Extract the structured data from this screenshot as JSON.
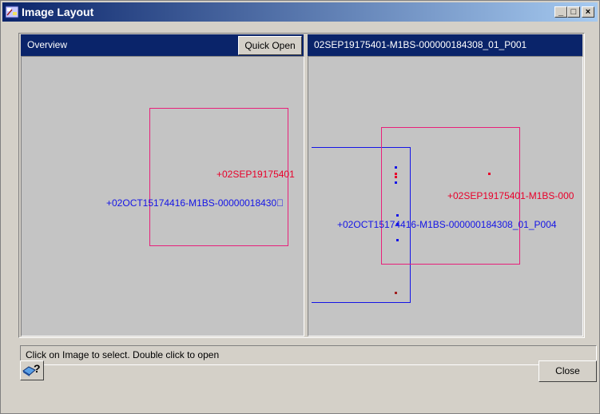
{
  "window": {
    "title": "Image Layout",
    "minimize_glyph": "_",
    "maximize_glyph": "□",
    "close_glyph": "×"
  },
  "overview_panel": {
    "header": "Overview",
    "quick_open_label": "Quick Open",
    "red_label": "+02SEP19175401",
    "blue_label": "+02OCT15174416-M1BS-00000018430\u0000",
    "colors": {
      "red": "#e8002a",
      "blue": "#1414e6",
      "footprint_pink": "#e8207a"
    }
  },
  "detail_panel": {
    "header": "02SEP19175401-M1BS-000000184308_01_P001",
    "red_label": "+02SEP19175401-M1BS-000",
    "blue_label": "+02OCT15174416-M1BS-000000184308_01_P004"
  },
  "status_bar": {
    "text": "Click on Image to select. Double click to open"
  },
  "help_button": {
    "icon": "help-book-icon",
    "glyph": "?"
  },
  "close_button": {
    "label": "Close"
  }
}
